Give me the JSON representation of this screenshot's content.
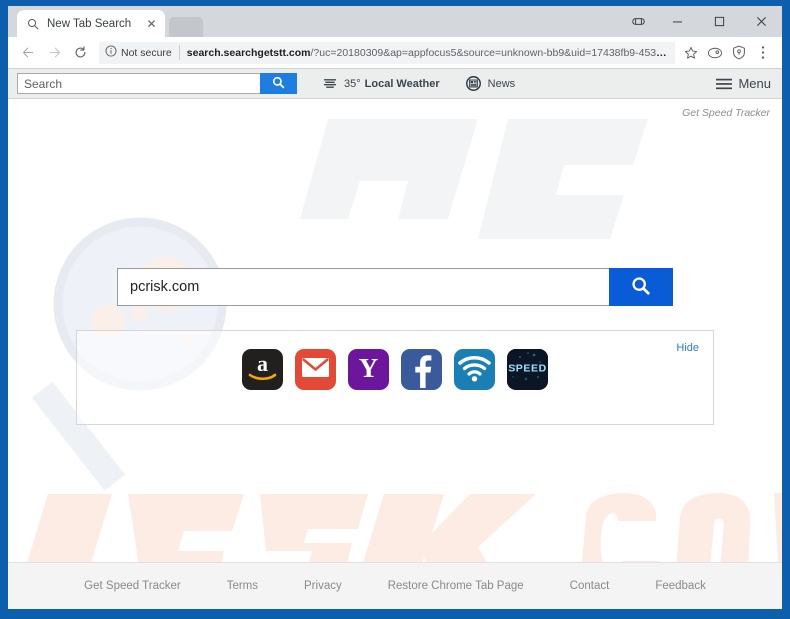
{
  "window": {
    "controls": {
      "extra_icon": "user-profile-icon",
      "minimize": "–",
      "maximize": "□",
      "close": "✕"
    }
  },
  "browser": {
    "tab": {
      "title": "New Tab Search",
      "favicon": "search-icon",
      "close_glyph": "✕"
    },
    "nav": {
      "back_glyph": "←",
      "forward_glyph": "→",
      "reload_glyph": "⟳"
    },
    "omnibox": {
      "security_label": "Not secure",
      "security_icon": "info-circle-icon",
      "url_host": "search.searchgetstt.com",
      "url_query": "/?uc=20180309&ap=appfocus5&source=unknown-bb9&uid=17438fb9-453a…",
      "bookmark_icon": "star-icon",
      "profile_icon": "avatar-icon",
      "shield_icon": "shield-icon",
      "menu_icon": "three-dot-menu-icon"
    }
  },
  "ext_toolbar": {
    "search_placeholder": "Search",
    "search_value": "",
    "search_button_icon": "magnifier-icon",
    "weather": {
      "icon": "weather-bars-icon",
      "temp": "35°",
      "label": "Local Weather"
    },
    "news": {
      "icon": "newspaper-icon",
      "label": "News"
    },
    "menu": {
      "icon": "hamburger-icon",
      "label": "Menu"
    }
  },
  "page": {
    "top_right_link": "Get Speed Tracker",
    "search": {
      "value": "pcrisk.com",
      "placeholder": "",
      "button_icon": "magnifier-icon"
    },
    "shortcuts_panel": {
      "hide_label": "Hide",
      "items": [
        {
          "name": "amazon",
          "label": "Amazon",
          "color": "#221f1f"
        },
        {
          "name": "gmail",
          "label": "Gmail",
          "color": "#e04a36"
        },
        {
          "name": "yahoo",
          "label": "Yahoo",
          "color": "#6c179b"
        },
        {
          "name": "facebook",
          "label": "Facebook",
          "color": "#3b5a9b"
        },
        {
          "name": "speedtest",
          "label": "Speed Test",
          "color": "#1b7fb5"
        },
        {
          "name": "speed",
          "label": "SPEED",
          "color": "#0a1624"
        }
      ]
    },
    "footer_links": [
      "Get Speed Tracker",
      "Terms",
      "Privacy",
      "Restore Chrome Tab Page",
      "Contact",
      "Feedback"
    ],
    "watermark": {
      "text_top": "PC",
      "text_bottom": "risk.com"
    }
  },
  "colors": {
    "window_frame": "#0d5fae",
    "accent_blue": "#0a5cd6",
    "toolbar_blue": "#1e7ee0",
    "link_blue": "#2a7fc9",
    "footer_text": "#8a8a8a"
  }
}
